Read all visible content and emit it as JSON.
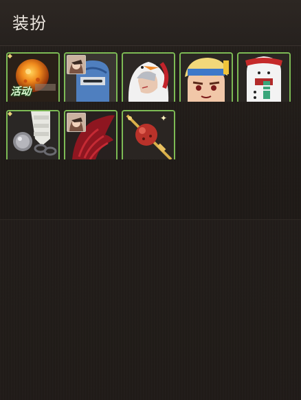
{
  "header": {
    "title": "装扮"
  },
  "items": [
    {
      "name": "fire-orb",
      "badge": "活动"
    },
    {
      "name": "blue-knight-helmet"
    },
    {
      "name": "snowman-hood"
    },
    {
      "name": "blonde-hero-hat"
    },
    {
      "name": "snowman-costume"
    },
    {
      "name": "silver-chain-boot"
    },
    {
      "name": "crimson-wings"
    },
    {
      "name": "ruby-scepter"
    }
  ]
}
